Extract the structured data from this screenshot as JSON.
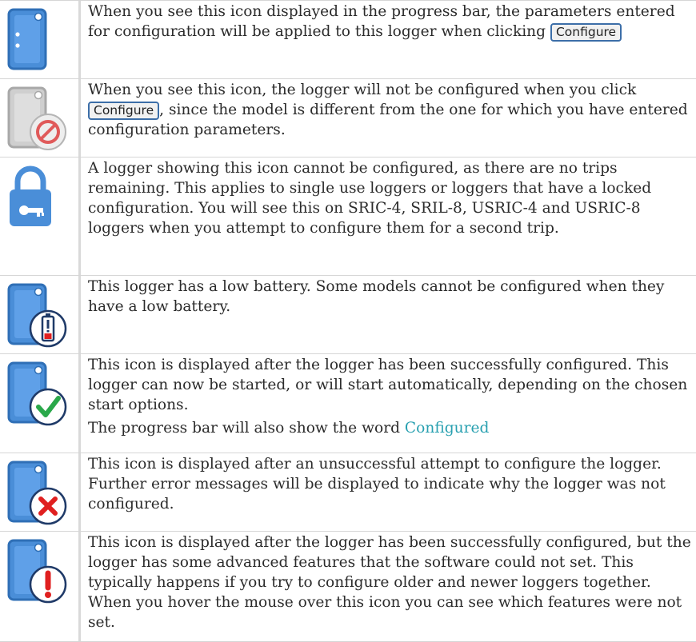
{
  "rows": [
    {
      "icon": "logger-configure-icon",
      "text_before": "When you see this icon displayed in the progress bar, the parameters entered for configuration will be applied to this logger when clicking ",
      "button": "Configure",
      "text_after": ""
    },
    {
      "icon": "logger-not-configured-icon",
      "text_before": "When you see this icon, the logger will not be configured when you click ",
      "button": "Configure",
      "text_after": ", since the model is different from the one for which you have entered configuration parameters."
    },
    {
      "icon": "lock-key-icon",
      "text": "A logger showing this icon cannot be configured, as there are no trips remaining. This applies to single use loggers or loggers that have a locked configuration. You will see this on SRIC-4, SRIL-8, USRIC-4 and USRIC-8 loggers when you attempt to configure them for a second trip."
    },
    {
      "icon": "logger-low-battery-icon",
      "text": "This logger has a low battery. Some models cannot be configured when they have a low battery."
    },
    {
      "icon": "logger-configured-check-icon",
      "text": "This icon is displayed after the logger has been successfully configured. This logger can now be started, or will start automatically, depending on the chosen start options.",
      "text2_before": "The progress bar will also show the word ",
      "text2_highlight": "Configured"
    },
    {
      "icon": "logger-error-icon",
      "text": "This icon is displayed after an unsuccessful attempt to configure the logger. Further error messages will be displayed to indicate why the logger was not configured."
    },
    {
      "icon": "logger-warning-icon",
      "text": "This icon is displayed after the logger has been successfully configured, but the logger has some advanced features that the software could not set. This typically happens if you try to configure older and newer loggers together. When you hover the mouse over this icon you can see which features were not set."
    }
  ],
  "colors": {
    "logger_blue": "#4a8ed8",
    "check_green": "#2aa84a",
    "error_red": "#e02020",
    "link_teal": "#28a0b0"
  }
}
